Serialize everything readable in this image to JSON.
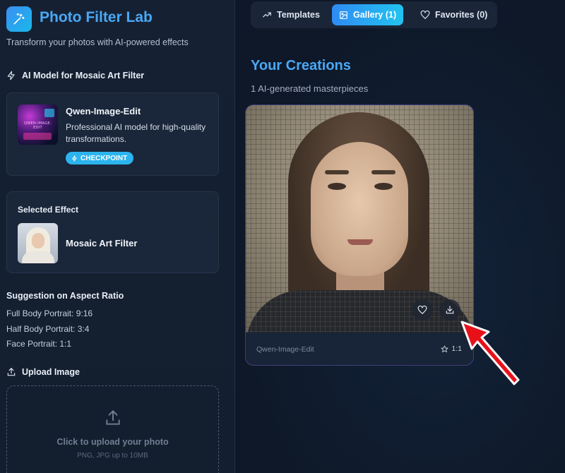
{
  "app": {
    "title": "Photo Filter Lab",
    "subtitle": "Transform your photos with AI-powered effects"
  },
  "model_section": {
    "heading": "AI Model for Mosaic Art Filter",
    "model_name": "Qwen-Image-Edit",
    "description": "Professional AI model for high-quality transformations.",
    "badge": "CHECKPOINT",
    "thumb_text": "QWEN-IMAGE-EDIT"
  },
  "effect_section": {
    "label": "Selected Effect",
    "effect_name": "Mosaic Art Filter"
  },
  "aspect": {
    "title": "Suggestion on Aspect Ratio",
    "lines": [
      "Full Body Portrait: 9:16",
      "Half Body Portrait: 3:4",
      "Face Portrait: 1:1"
    ]
  },
  "upload": {
    "heading": "Upload Image",
    "main_text": "Click to upload your photo",
    "sub_text": "PNG, JPG up to 10MB"
  },
  "tabs": [
    {
      "label": "Templates",
      "icon": "trending-icon",
      "active": false
    },
    {
      "label": "Gallery (1)",
      "icon": "image-icon",
      "active": true
    },
    {
      "label": "Favorites (0)",
      "icon": "heart-icon",
      "active": false
    }
  ],
  "gallery": {
    "title": "Your Creations",
    "count_text": "1 AI-generated masterpieces",
    "items": [
      {
        "model": "Qwen-Image-Edit",
        "ratio": "1:1"
      }
    ]
  },
  "colors": {
    "accent": "#4aa8f5",
    "tab_active_start": "#2f8bf3",
    "tab_active_end": "#22c3ef",
    "badge": "#2cb4ef",
    "pointer_arrow": "#e8111a"
  }
}
